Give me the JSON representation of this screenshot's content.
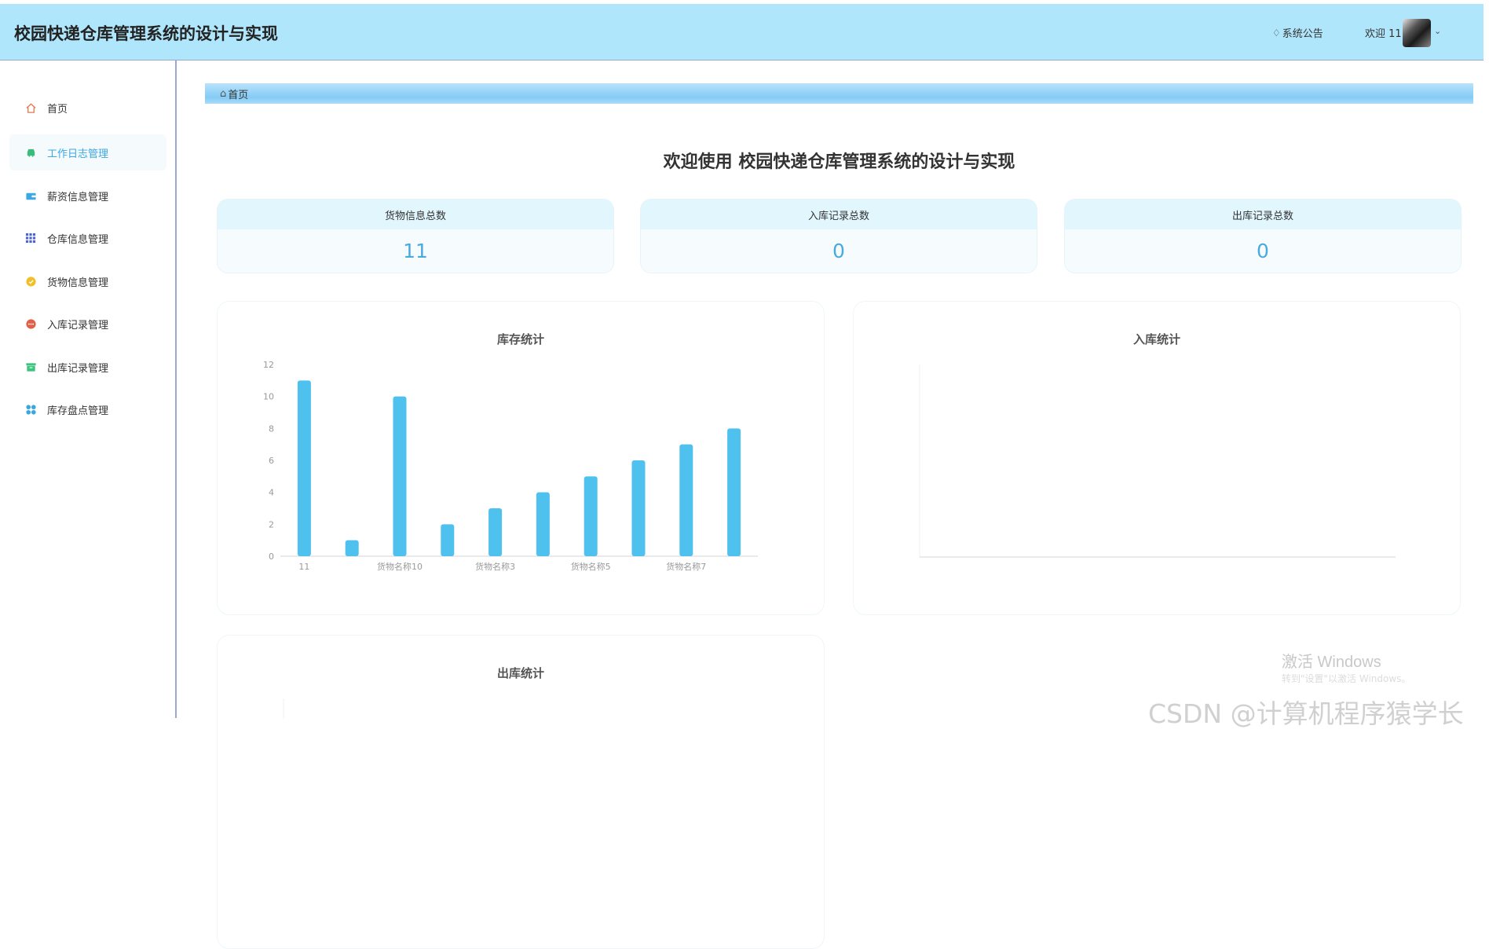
{
  "header": {
    "title": "校园快递仓库管理系统的设计与实现",
    "notice_label": "系统公告",
    "welcome_label": "欢迎 11"
  },
  "sidebar": {
    "items": [
      {
        "label": "首页",
        "icon": "home-icon",
        "color": "#e07a4f"
      },
      {
        "label": "工作日志管理",
        "icon": "car-icon",
        "color": "#3dbb7a",
        "active": true
      },
      {
        "label": "薪资信息管理",
        "icon": "wallet-icon",
        "color": "#3ca8e4"
      },
      {
        "label": "仓库信息管理",
        "icon": "grid-icon",
        "color": "#4a63d8"
      },
      {
        "label": "货物信息管理",
        "icon": "coin-icon",
        "color": "#f0c02a"
      },
      {
        "label": "入库记录管理",
        "icon": "dots-icon",
        "color": "#e0604a"
      },
      {
        "label": "出库记录管理",
        "icon": "archive-icon",
        "color": "#3cc47e"
      },
      {
        "label": "库存盘点管理",
        "icon": "apps-icon",
        "color": "#39a7e0"
      }
    ]
  },
  "breadcrumb": {
    "label": "首页"
  },
  "main": {
    "welcome": "欢迎使用 校园快递仓库管理系统的设计与实现",
    "stats": [
      {
        "label": "货物信息总数",
        "value": "11"
      },
      {
        "label": "入库记录总数",
        "value": "0"
      },
      {
        "label": "出库记录总数",
        "value": "0"
      }
    ],
    "charts": {
      "stock": {
        "title": "库存统计"
      },
      "inbound": {
        "title": "入库统计"
      },
      "outbound": {
        "title": "出库统计"
      }
    }
  },
  "chart_data": [
    {
      "type": "bar",
      "title": "库存统计",
      "categories": [
        "11",
        "",
        "货物名称10",
        "",
        "货物名称3",
        "",
        "货物名称5",
        "",
        "货物名称7",
        ""
      ],
      "values": [
        11,
        1,
        10,
        2,
        3,
        4,
        5,
        6,
        7,
        8
      ],
      "ylim": [
        0,
        12
      ],
      "yticks": [
        0,
        2,
        4,
        6,
        8,
        10,
        12
      ],
      "color": "#4fc1ee"
    },
    {
      "type": "bar",
      "title": "入库统计",
      "categories": [],
      "values": []
    },
    {
      "type": "bar",
      "title": "出库统计",
      "categories": [],
      "values": []
    }
  ],
  "watermark": {
    "activate_title": "激活 Windows",
    "activate_sub": "转到\"设置\"以激活 Windows。",
    "csdn": "CSDN @计算机程序猿学长"
  }
}
